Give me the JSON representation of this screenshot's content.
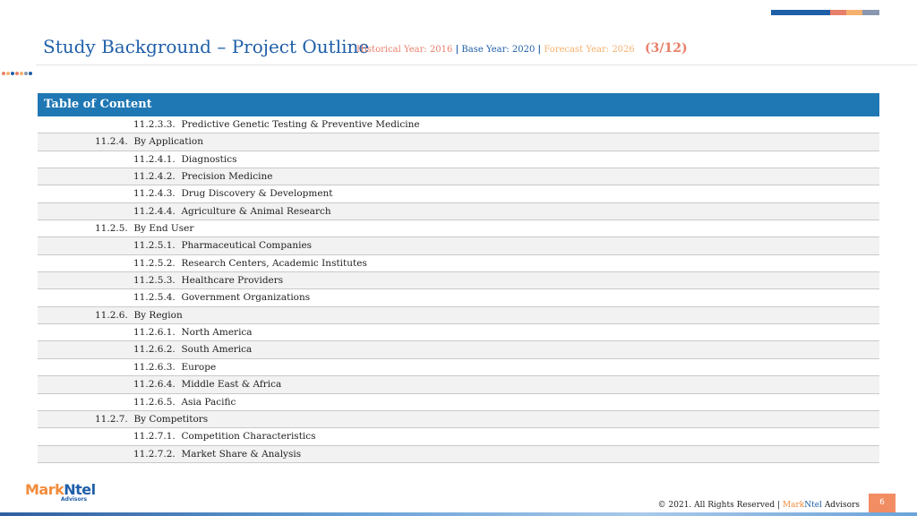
{
  "header": {
    "title": "Study Background – Project Outline",
    "historical": "Historical Year: 2016",
    "sep1": "|",
    "base": "Base Year: 2020",
    "sep2": "|",
    "forecast": "Forecast Year: 2026",
    "page_of": "(3/12)"
  },
  "table": {
    "heading": "Table of Content",
    "rows": [
      {
        "num": "11.2.3.3.",
        "text": "Predictive Genetic Testing & Preventive Medicine",
        "level": 2
      },
      {
        "num": "11.2.4.",
        "text": "By Application",
        "level": 1
      },
      {
        "num": "11.2.4.1.",
        "text": "Diagnostics",
        "level": 2
      },
      {
        "num": "11.2.4.2.",
        "text": "Precision Medicine",
        "level": 2
      },
      {
        "num": "11.2.4.3.",
        "text": "Drug Discovery & Development",
        "level": 2
      },
      {
        "num": "11.2.4.4.",
        "text": "Agriculture & Animal Research",
        "level": 2
      },
      {
        "num": "11.2.5.",
        "text": "By End User",
        "level": 1
      },
      {
        "num": "11.2.5.1.",
        "text": "Pharmaceutical Companies",
        "level": 2
      },
      {
        "num": "11.2.5.2.",
        "text": "Research Centers, Academic Institutes",
        "level": 2
      },
      {
        "num": "11.2.5.3.",
        "text": "Healthcare Providers",
        "level": 2
      },
      {
        "num": "11.2.5.4.",
        "text": "Government Organizations",
        "level": 2
      },
      {
        "num": "11.2.6.",
        "text": "By Region",
        "level": 1
      },
      {
        "num": "11.2.6.1.",
        "text": "North America",
        "level": 2
      },
      {
        "num": "11.2.6.2.",
        "text": "South America",
        "level": 2
      },
      {
        "num": "11.2.6.3.",
        "text": "Europe",
        "level": 2
      },
      {
        "num": "11.2.6.4.",
        "text": "Middle East & Africa",
        "level": 2
      },
      {
        "num": "11.2.6.5.",
        "text": "Asia Pacific",
        "level": 2
      },
      {
        "num": "11.2.7.",
        "text": "By Competitors",
        "level": 1
      },
      {
        "num": "11.2.7.1.",
        "text": "Competition Characteristics",
        "level": 2
      },
      {
        "num": "11.2.7.2.",
        "text": "Market Share & Analysis",
        "level": 2
      }
    ]
  },
  "logo": {
    "mark": "Mark",
    "ntel": "Ntel",
    "sub": "Advisors"
  },
  "footer": {
    "copyright": "© 2021. All Rights Reserved",
    "sep": "|",
    "brand_mark": "Mark",
    "brand_ntel": "Ntel",
    "brand_rest": "Advisors",
    "page_number": "6"
  },
  "colors": {
    "title_blue": "#1f5fa8",
    "header_bar": "#1f77b4",
    "historical": "#e87f6a",
    "base": "#1f5fa8",
    "forecast": "#f5b16e",
    "page_badge": "#f28c62"
  }
}
